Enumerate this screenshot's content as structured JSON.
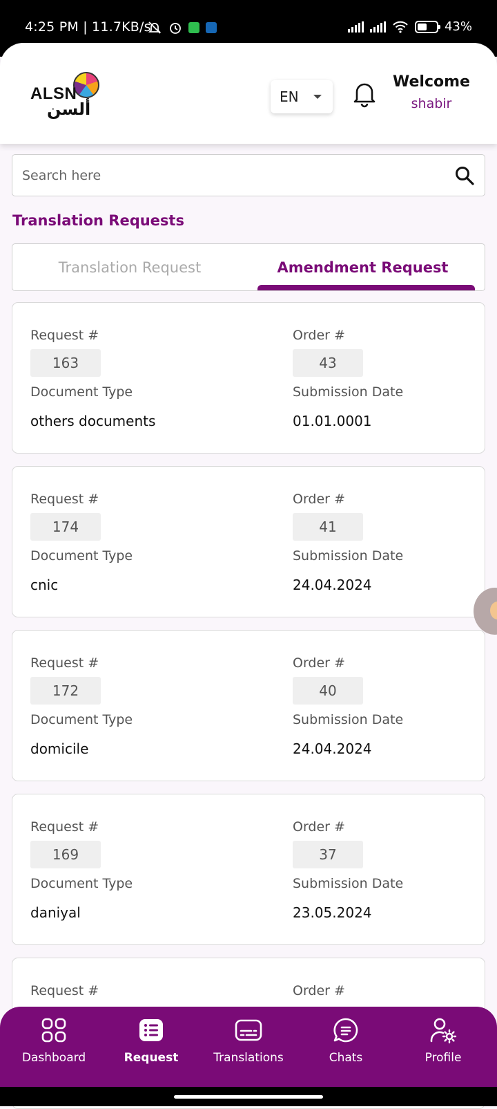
{
  "status_bar": {
    "time": "4:25 PM | 11.7KB/s",
    "battery": "43%"
  },
  "header": {
    "logo_text": "ALSN",
    "logo_arabic": "ألسن",
    "language": "EN",
    "welcome_title": "Welcome",
    "welcome_name": "shabir"
  },
  "search": {
    "placeholder": "Search here"
  },
  "section_title": "Translation Requests",
  "tabs": [
    {
      "label": "Translation Request",
      "active": false
    },
    {
      "label": "Amendment Request",
      "active": true
    }
  ],
  "field_labels": {
    "request": "Request #",
    "order": "Order #",
    "document_type": "Document Type",
    "submission_date": "Submission Date"
  },
  "requests": [
    {
      "request_no": "163",
      "order_no": "43",
      "document_type": "others documents",
      "submission_date": "01.01.0001"
    },
    {
      "request_no": "174",
      "order_no": "41",
      "document_type": "cnic",
      "submission_date": "24.04.2024"
    },
    {
      "request_no": "172",
      "order_no": "40",
      "document_type": "domicile",
      "submission_date": "24.04.2024"
    },
    {
      "request_no": "169",
      "order_no": "37",
      "document_type": "daniyal",
      "submission_date": "23.05.2024"
    }
  ],
  "bottom_nav": [
    {
      "label": "Dashboard",
      "icon": "dashboard-grid-icon",
      "active": false
    },
    {
      "label": "Request",
      "icon": "request-list-icon",
      "active": true
    },
    {
      "label": "Translations",
      "icon": "translations-subtitle-icon",
      "active": false
    },
    {
      "label": "Chats",
      "icon": "chat-bubble-icon",
      "active": false
    },
    {
      "label": "Profile",
      "icon": "profile-settings-icon",
      "active": false
    }
  ],
  "colors": {
    "brand": "#7a0b77",
    "background": "#faf6fb",
    "card_border": "#d9d9d9",
    "pill_bg": "#efefef"
  }
}
